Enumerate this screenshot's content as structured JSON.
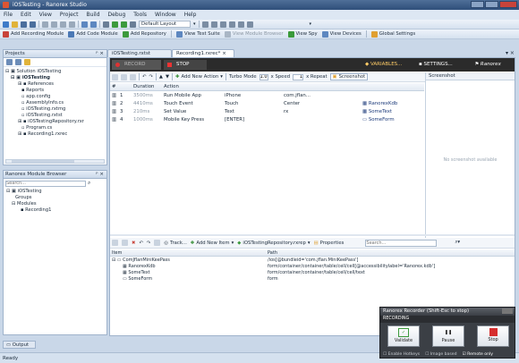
{
  "window": {
    "title": "iOSTesting - Ranorex Studio"
  },
  "menu": [
    "File",
    "Edit",
    "View",
    "Project",
    "Build",
    "Debug",
    "Tools",
    "Window",
    "Help"
  ],
  "toolbar1": {
    "layout_select": "Default Layout"
  },
  "toolbar2": [
    "Add Recording Module",
    "Add Code Module",
    "Add Repository",
    "View Test Suite",
    "View Module Browser",
    "View Spy",
    "View Devices",
    "Global Settings"
  ],
  "projects_panel": {
    "title": "Projects",
    "tree": [
      {
        "label": "Solution iOSTesting",
        "indent": 0
      },
      {
        "label": "iOSTesting",
        "indent": 1
      },
      {
        "label": "References",
        "indent": 2
      },
      {
        "label": "Reports",
        "indent": 2
      },
      {
        "label": "app.config",
        "indent": 2
      },
      {
        "label": "AssemblyInfo.cs",
        "indent": 2
      },
      {
        "label": "iOSTesting.rxtmg",
        "indent": 2
      },
      {
        "label": "iOSTesting.rxtst",
        "indent": 2
      },
      {
        "label": "iOSTestingRepository.rxr",
        "indent": 2
      },
      {
        "label": "Program.cs",
        "indent": 2
      },
      {
        "label": "Recording1.rxrec",
        "indent": 2
      }
    ]
  },
  "module_browser": {
    "title": "Ranorex Module Browser",
    "search_placeholder": "Search...",
    "tree": [
      {
        "label": "iOSTesting",
        "indent": 0
      },
      {
        "label": "Groups",
        "indent": 1
      },
      {
        "label": "Modules",
        "indent": 1
      },
      {
        "label": "Recording1",
        "indent": 2
      }
    ]
  },
  "doc_tabs": [
    "iOSTesting.rxtst",
    "Recording1.rxrec*"
  ],
  "recording_bar": {
    "record": "RECORD",
    "stop": "STOP",
    "variables": "VARIABLES...",
    "settings": "SETTINGS...",
    "brand": "Ranorex"
  },
  "actions_toolbar": {
    "add_new_action": "Add New Action",
    "turbo_mode": "Turbo Mode",
    "speed_value": "1.0",
    "speed_label": "x Speed",
    "repeat_value": "1",
    "repeat_label": "x Repeat",
    "screenshot": "Screenshot"
  },
  "actions_table": {
    "columns": [
      "#",
      "Duration",
      "Action",
      "",
      "",
      ""
    ],
    "rows": [
      {
        "num": "1",
        "duration": "3500ms",
        "action": "Run Mobile App",
        "c1": "iPhone",
        "c2": "com.jflan...",
        "c3": ""
      },
      {
        "num": "2",
        "duration": "4410ms",
        "action": "Touch Event",
        "c1": "Touch",
        "c2": "Center",
        "c3": "RanorexKdb"
      },
      {
        "num": "3",
        "duration": "210ms",
        "action": "Set Value",
        "c1": "Text",
        "c2": "rx",
        "c3": "SomeText"
      },
      {
        "num": "4",
        "duration": "1000ms",
        "action": "Mobile Key Press",
        "c1": "[ENTER]",
        "c2": "",
        "c3": "SomeForm"
      }
    ]
  },
  "screenshot_panel": {
    "title": "Screenshot",
    "empty": "No screenshot available"
  },
  "repo_toolbar": {
    "track": "Track...",
    "add_new_item": "Add New Item",
    "repository": "iOSTestingRepository.rxrep",
    "properties": "Properties",
    "search_placeholder": "Search..."
  },
  "repo_table": {
    "columns": [
      "Item",
      "Path"
    ],
    "rows": [
      {
        "item": "ComJflanMiniKeePass",
        "path": "/ios[@bundleid='com.jflan.MiniKeePass']",
        "indent": 0
      },
      {
        "item": "RanorexKdb",
        "path": "form/container/container/table/cell/cell[@accessibilitylabel='Ranorex.kdb']",
        "indent": 1
      },
      {
        "item": "SomeText",
        "path": "form/container/container/table/cell/cell/text",
        "indent": 1
      },
      {
        "item": "SomeForm",
        "path": "form",
        "indent": 1
      }
    ]
  },
  "recorder": {
    "title": "Ranorex Recorder (Shift-Esc to stop)",
    "status": "RECORDING",
    "validate": "Validate",
    "pause": "Pause",
    "stop": "Stop",
    "enable_hotkeys": "Enable Hotkeys",
    "image_based": "Image based",
    "remote_only": "Remote only"
  },
  "output_tab": "Output",
  "status": "Ready"
}
